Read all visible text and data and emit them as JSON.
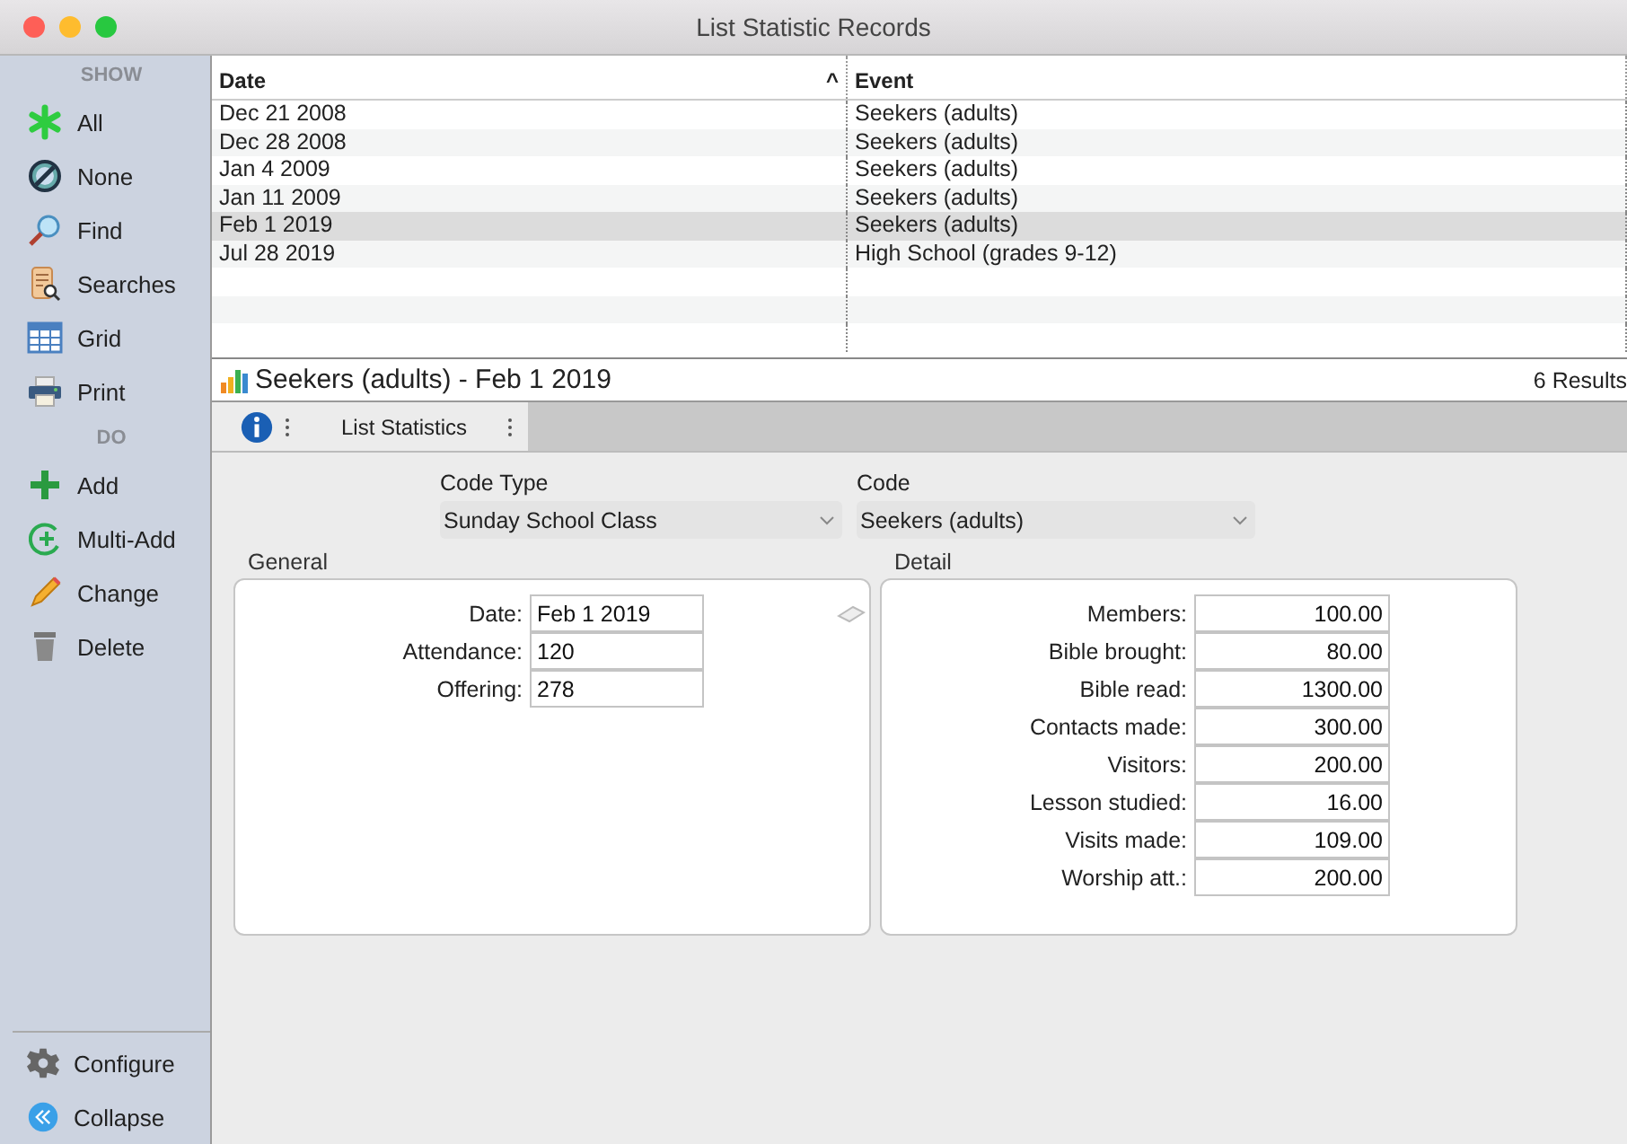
{
  "window": {
    "title": "List Statistic Records"
  },
  "sidebar": {
    "sections": [
      {
        "heading": "SHOW",
        "items": [
          {
            "label": "All"
          },
          {
            "label": "None"
          },
          {
            "label": "Find"
          },
          {
            "label": "Searches"
          },
          {
            "label": "Grid"
          },
          {
            "label": "Print"
          }
        ]
      },
      {
        "heading": "DO",
        "items": [
          {
            "label": "Add"
          },
          {
            "label": "Multi-Add"
          },
          {
            "label": "Change"
          },
          {
            "label": "Delete"
          }
        ]
      }
    ],
    "footer": [
      {
        "label": "Configure"
      },
      {
        "label": "Collapse"
      }
    ]
  },
  "table": {
    "columns": [
      {
        "label": "Date",
        "sort": "^"
      },
      {
        "label": "Event"
      }
    ],
    "rows": [
      {
        "date": "Dec 21 2008",
        "event": "Seekers (adults)",
        "selected": false
      },
      {
        "date": "Dec 28 2008",
        "event": "Seekers (adults)",
        "selected": false
      },
      {
        "date": "Jan 4 2009",
        "event": "Seekers (adults)",
        "selected": false
      },
      {
        "date": "Jan 11 2009",
        "event": "Seekers (adults)",
        "selected": false
      },
      {
        "date": "Feb 1 2019",
        "event": "Seekers (adults)",
        "selected": true
      },
      {
        "date": "Jul 28 2019",
        "event": "High School (grades 9-12)",
        "selected": false
      }
    ]
  },
  "record_bar": {
    "title": "Seekers (adults) - Feb 1 2019",
    "count": "6 Results"
  },
  "tabs": [
    {
      "label": "List Statistics",
      "selected": true
    }
  ],
  "form": {
    "code_type": {
      "label": "Code Type",
      "value": "Sunday School Class"
    },
    "code": {
      "label": "Code",
      "value": "Seekers (adults)"
    },
    "general": {
      "title": "General",
      "fields": [
        {
          "label": "Date:",
          "value": "Feb 1 2019"
        },
        {
          "label": "Attendance:",
          "value": "120"
        },
        {
          "label": "Offering:",
          "value": "278"
        }
      ]
    },
    "detail": {
      "title": "Detail",
      "fields": [
        {
          "label": "Members:",
          "value": "100.00"
        },
        {
          "label": "Bible brought:",
          "value": "80.00"
        },
        {
          "label": "Bible read:",
          "value": "1300.00"
        },
        {
          "label": "Contacts made:",
          "value": "300.00"
        },
        {
          "label": "Visitors:",
          "value": "200.00"
        },
        {
          "label": "Lesson studied:",
          "value": "16.00"
        },
        {
          "label": "Visits made:",
          "value": "109.00"
        },
        {
          "label": "Worship att.:",
          "value": "200.00"
        }
      ]
    }
  }
}
